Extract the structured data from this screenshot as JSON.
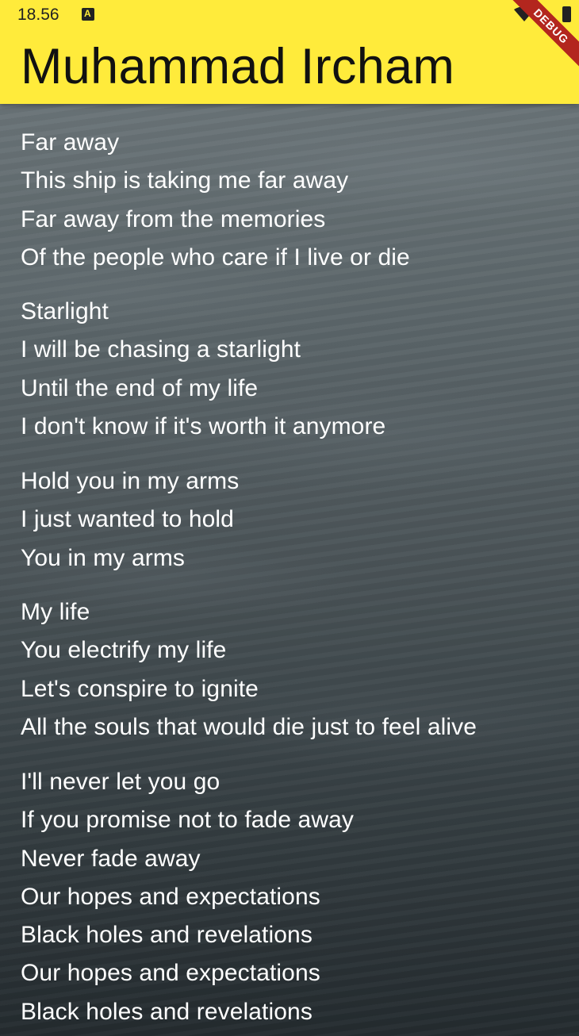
{
  "status_bar": {
    "time": "18.56",
    "debug_banner": "DEBUG"
  },
  "app_bar": {
    "title": "Muhammad Ircham",
    "color": "#ffeb3b"
  },
  "lyrics": {
    "stanzas": [
      {
        "lines": [
          "Far away",
          "This ship is taking me far away",
          "Far away from the memories",
          "Of the people who care if I live or die"
        ]
      },
      {
        "lines": [
          "Starlight",
          "I will be chasing a starlight",
          "Until the end of my life",
          "I don't know if it's worth it anymore"
        ]
      },
      {
        "lines": [
          "Hold you in my arms",
          "I just wanted to hold",
          "You in my arms"
        ]
      },
      {
        "lines": [
          "My life",
          "You electrify my life",
          "Let's conspire to ignite",
          "All the souls that would die just to feel alive"
        ]
      },
      {
        "lines": [
          "I'll never let you go",
          "If you promise not to fade away",
          "Never fade away",
          "Our hopes and expectations",
          "Black holes and revelations",
          "Our hopes and expectations",
          "Black holes and revelations"
        ]
      }
    ]
  }
}
